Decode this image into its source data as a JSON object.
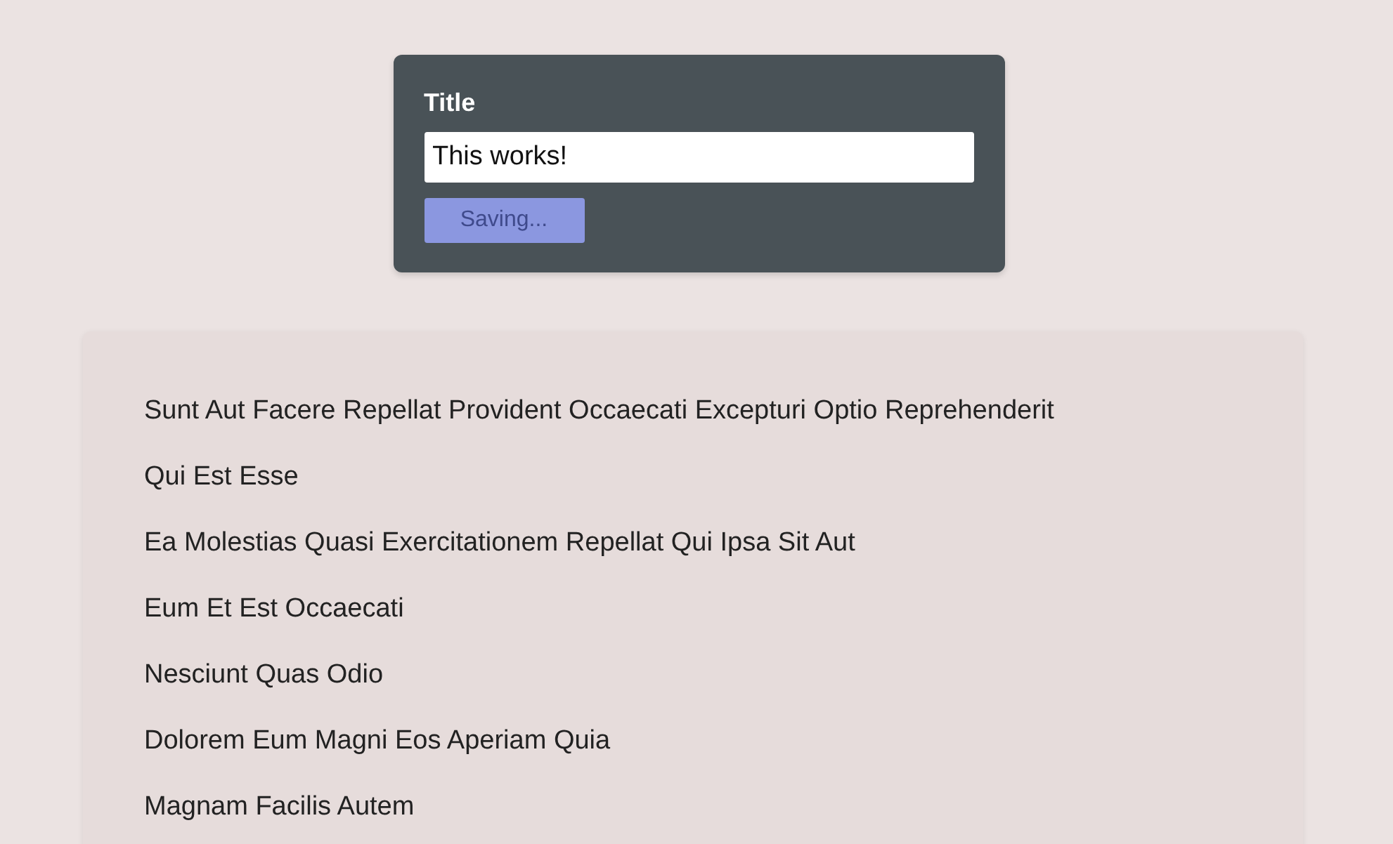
{
  "form": {
    "label": "Title",
    "input_value": "This works!",
    "button": {
      "label": "Saving...",
      "disabled": true
    }
  },
  "posts": [
    "Sunt Aut Facere Repellat Provident Occaecati Excepturi Optio Reprehenderit",
    "Qui Est Esse",
    "Ea Molestias Quasi Exercitationem Repellat Qui Ipsa Sit Aut",
    "Eum Et Est Occaecati",
    "Nesciunt Quas Odio",
    "Dolorem Eum Magni Eos Aperiam Quia",
    "Magnam Facilis Autem"
  ]
}
